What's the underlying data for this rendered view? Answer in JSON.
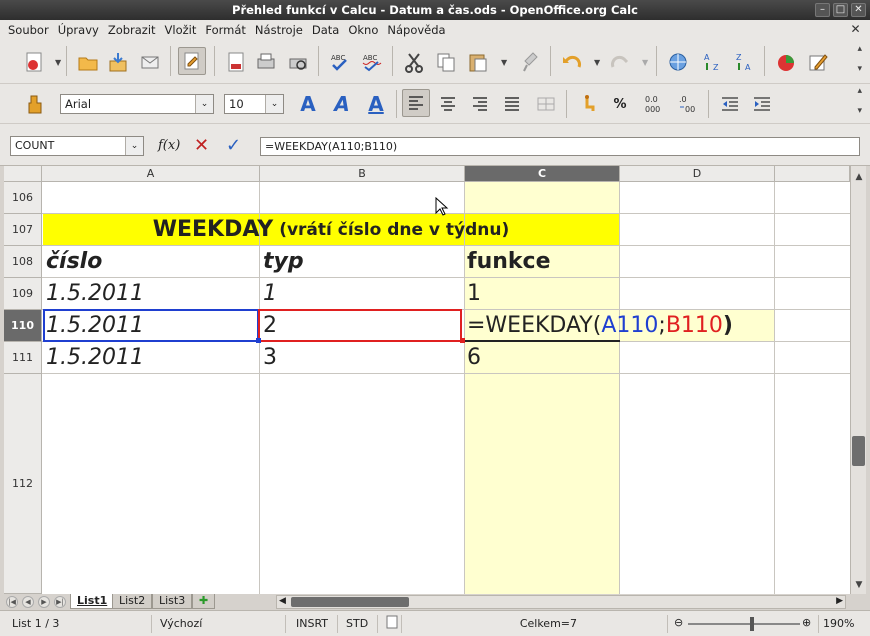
{
  "window": {
    "title": "Přehled funkcí v Calcu - Datum a čas.ods - OpenOffice.org Calc"
  },
  "menu": [
    {
      "label": "Soubor"
    },
    {
      "label": "Úpravy"
    },
    {
      "label": "Zobrazit"
    },
    {
      "label": "Vložit"
    },
    {
      "label": "Formát"
    },
    {
      "label": "Nástroje"
    },
    {
      "label": "Data"
    },
    {
      "label": "Okno"
    },
    {
      "label": "Nápověda"
    }
  ],
  "format": {
    "font_name": "Arial",
    "font_size": "10"
  },
  "formula_bar": {
    "name_box": "COUNT",
    "content": "=WEEKDAY(A110;B110)"
  },
  "columns": [
    "A",
    "B",
    "C",
    "D"
  ],
  "rows": [
    "106",
    "107",
    "108",
    "109",
    "110",
    "111",
    "112"
  ],
  "sheet": {
    "title_main": "WEEKDAY",
    "title_sub": "(vrátí číslo dne v týdnu)",
    "headers": {
      "a": "číslo",
      "b": "typ",
      "c": "funkce"
    },
    "r109": {
      "a": "1.5.2011",
      "b": "1",
      "c": "1"
    },
    "r110": {
      "a": "1.5.2011",
      "b": "2",
      "c_func": "=WEEKDAY(",
      "c_ref1": "A110",
      "c_sep": ";",
      "c_ref2": "B110",
      "c_close": ")"
    },
    "r111": {
      "a": "1.5.2011",
      "b": "3",
      "c": "6"
    }
  },
  "tabs": [
    "List1",
    "List2",
    "List3"
  ],
  "status": {
    "sheet": "List 1 / 3",
    "style": "Výchozí",
    "insert": "INSRT",
    "mode": "STD",
    "sum": "Celkem=7",
    "zoom": "190%"
  },
  "colors": {
    "title_bg": "#ffff00",
    "col_c_bg": "#ffffd0",
    "ref1": "#1f3fd0",
    "ref2": "#e02020"
  }
}
